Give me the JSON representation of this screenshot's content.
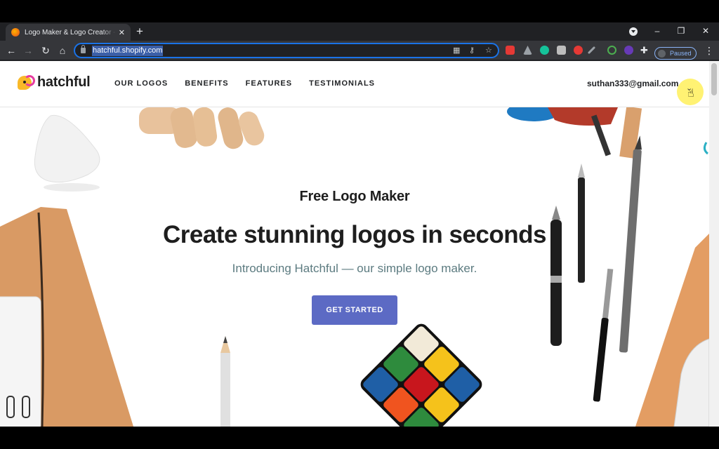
{
  "browser": {
    "tab_title": "Logo Maker & Logo Creator - Free",
    "url": "hatchful.shopify.com",
    "profile_status": "Paused"
  },
  "site": {
    "logo_text": "hatchful",
    "nav": [
      "OUR LOGOS",
      "BENEFITS",
      "FEATURES",
      "TESTIMONIALS"
    ],
    "account_email": "suthan333@gmail.com"
  },
  "hero": {
    "kicker": "Free Logo Maker",
    "title": "Create stunning logos in seconds",
    "subtitle": "Introducing Hatchful — our simple logo maker.",
    "cta": "GET STARTED"
  },
  "colors": {
    "accent": "#5c6ac4",
    "omnibox_focus": "#1a73e8",
    "subtitle": "#5c7b80"
  },
  "icons": [
    "back-icon",
    "forward-icon",
    "reload-icon",
    "home-icon",
    "lock-icon",
    "qr-icon",
    "key-icon",
    "star-icon",
    "extensions-icon",
    "menu-icon",
    "chevron-down-icon",
    "hand-pointer-icon"
  ]
}
